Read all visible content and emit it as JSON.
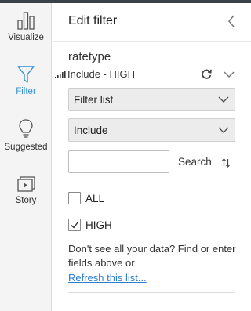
{
  "rail": {
    "items": [
      {
        "label": "Visualize",
        "icon": "bar-chart-icon",
        "active": false
      },
      {
        "label": "Filter",
        "icon": "funnel-icon",
        "active": true
      },
      {
        "label": "Suggested",
        "icon": "lightbulb-icon",
        "active": false
      },
      {
        "label": "Story",
        "icon": "story-play-icon",
        "active": false
      }
    ]
  },
  "panel": {
    "title": "Edit filter",
    "collapse_icon": "chevron-left-icon",
    "field": {
      "name": "ratetype",
      "summary": "Include - HIGH",
      "type_icon": "signal-bars-icon"
    },
    "filter_type_select": {
      "value": "Filter list"
    },
    "mode_select": {
      "value": "Include"
    },
    "search": {
      "value": "",
      "placeholder": "",
      "button_label": "Search"
    },
    "options": [
      {
        "label": "ALL",
        "checked": false
      },
      {
        "label": "HIGH",
        "checked": true
      }
    ],
    "hint_text": "Don't see all your data? Find or enter fields above or",
    "refresh_link": "Refresh this list..."
  },
  "colors": {
    "accent": "#2f8fd8",
    "link": "#2f7fd0",
    "rail_bg": "#f4f4f4",
    "select_bg": "#ececec",
    "topbar": "#3a4148"
  }
}
